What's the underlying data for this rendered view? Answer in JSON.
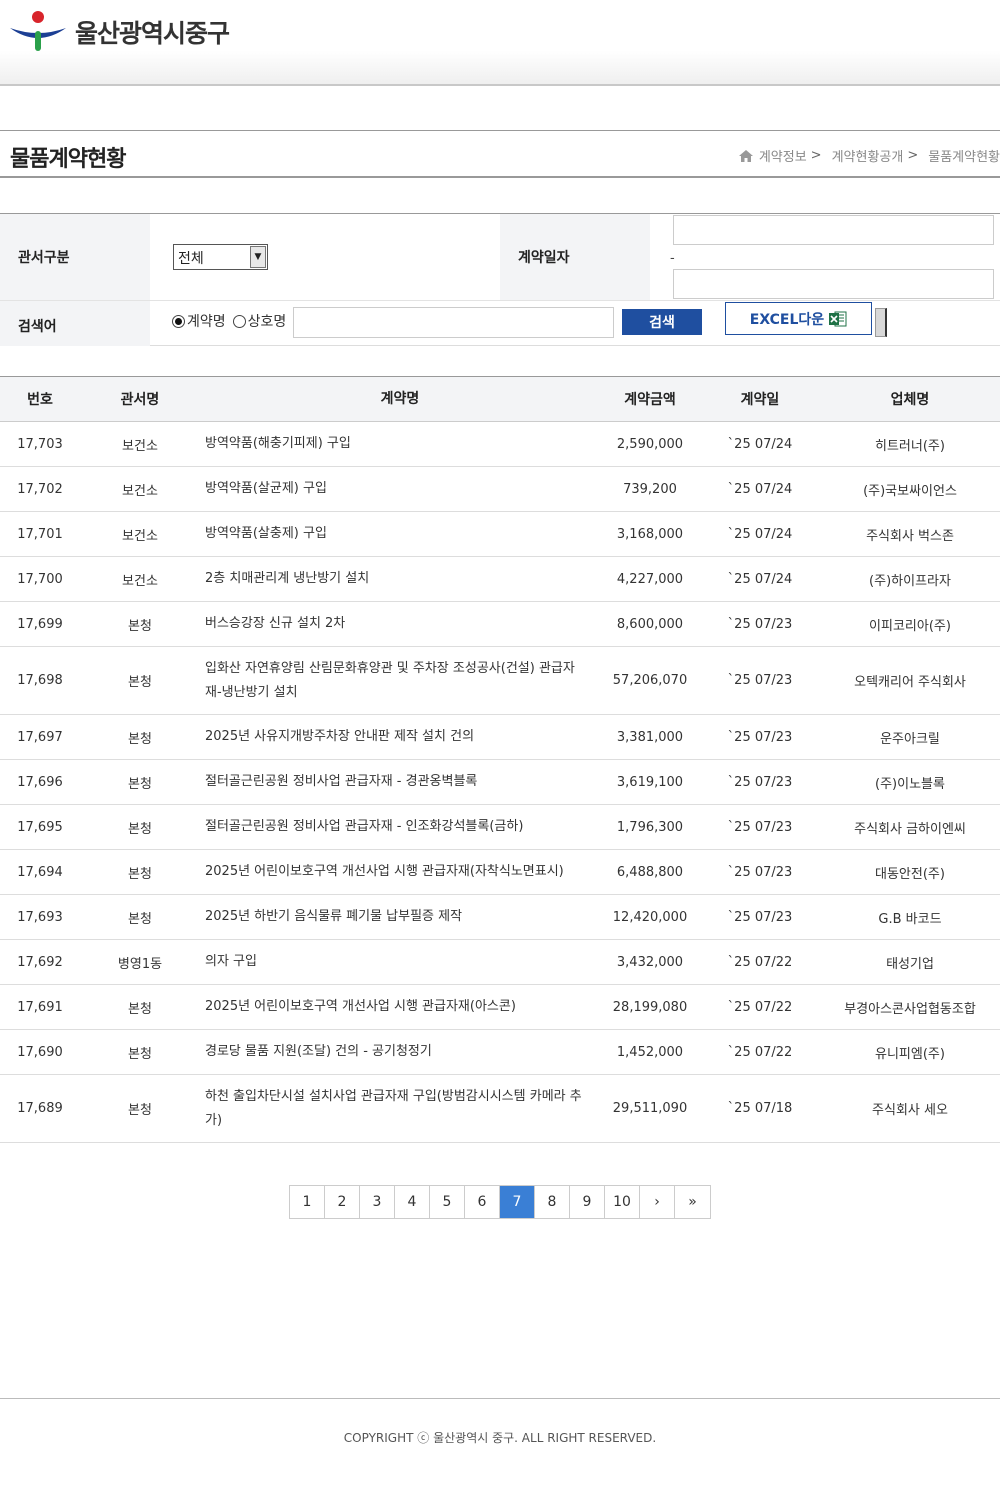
{
  "header": {
    "brand": "울산광역시중구"
  },
  "page": {
    "title": "물품계약현황",
    "breadcrumb": [
      "계약정보",
      "계약현황공개",
      "물품계약현황"
    ],
    "breadcrumb_sep": ">"
  },
  "search": {
    "dept_label": "관서구분",
    "dept_selected": "전체",
    "date_label": "계약일자",
    "date_sep": "-",
    "keyword_label": "검색어",
    "radio_contract": "계약명",
    "radio_company": "상호명",
    "search_button": "검색",
    "excel_button": "EXCEL다운"
  },
  "table": {
    "headers": [
      "번호",
      "관서명",
      "계약명",
      "계약금액",
      "계약일",
      "업체명"
    ],
    "rows": [
      {
        "no": "17,703",
        "dept": "보건소",
        "name": "방역약품(해충기피제) 구입",
        "amount": "2,590,000",
        "date": "`25 07/24",
        "vendor": "히트러너(주)"
      },
      {
        "no": "17,702",
        "dept": "보건소",
        "name": "방역약품(살균제) 구입",
        "amount": "739,200",
        "date": "`25 07/24",
        "vendor": "(주)국보싸이언스"
      },
      {
        "no": "17,701",
        "dept": "보건소",
        "name": "방역약품(살충제) 구입",
        "amount": "3,168,000",
        "date": "`25 07/24",
        "vendor": "주식회사 벅스존"
      },
      {
        "no": "17,700",
        "dept": "보건소",
        "name": "2층 치매관리계 냉난방기 설치",
        "amount": "4,227,000",
        "date": "`25 07/24",
        "vendor": "(주)하이프라자"
      },
      {
        "no": "17,699",
        "dept": "본청",
        "name": "버스승강장 신규 설치 2차",
        "amount": "8,600,000",
        "date": "`25 07/23",
        "vendor": "이피코리아(주)"
      },
      {
        "no": "17,698",
        "dept": "본청",
        "name": "입화산 자연휴양림 산림문화휴양관 및 주차장 조성공사(건설) 관급자재-냉난방기 설치",
        "amount": "57,206,070",
        "date": "`25 07/23",
        "vendor": "오텍캐리어 주식회사"
      },
      {
        "no": "17,697",
        "dept": "본청",
        "name": "2025년 사유지개방주차장 안내판 제작 설치 건의",
        "amount": "3,381,000",
        "date": "`25 07/23",
        "vendor": "운주아크릴"
      },
      {
        "no": "17,696",
        "dept": "본청",
        "name": "절터골근린공원 정비사업 관급자재 - 경관옹벽블록",
        "amount": "3,619,100",
        "date": "`25 07/23",
        "vendor": "(주)이노블록"
      },
      {
        "no": "17,695",
        "dept": "본청",
        "name": "절터골근린공원 정비사업 관급자재 - 인조화강석블록(금하)",
        "amount": "1,796,300",
        "date": "`25 07/23",
        "vendor": "주식회사 금하이엔씨"
      },
      {
        "no": "17,694",
        "dept": "본청",
        "name": "2025년 어린이보호구역 개선사업 시행 관급자재(자착식노면표시)",
        "amount": "6,488,800",
        "date": "`25 07/23",
        "vendor": "대동안전(주)"
      },
      {
        "no": "17,693",
        "dept": "본청",
        "name": "2025년 하반기 음식물류 폐기물 납부필증 제작",
        "amount": "12,420,000",
        "date": "`25 07/23",
        "vendor": "G.B 바코드"
      },
      {
        "no": "17,692",
        "dept": "병영1동",
        "name": "의자 구입",
        "amount": "3,432,000",
        "date": "`25 07/22",
        "vendor": "태성기업"
      },
      {
        "no": "17,691",
        "dept": "본청",
        "name": "2025년 어린이보호구역 개선사업 시행 관급자재(아스콘)",
        "amount": "28,199,080",
        "date": "`25 07/22",
        "vendor": "부경아스콘사업협동조합"
      },
      {
        "no": "17,690",
        "dept": "본청",
        "name": "경로당 물품 지원(조달) 건의 - 공기청정기",
        "amount": "1,452,000",
        "date": "`25 07/22",
        "vendor": "유니피엠(주)"
      },
      {
        "no": "17,689",
        "dept": "본청",
        "name": "하천 출입차단시설 설치사업 관급자재 구입(방범감시시스템 카메라 추가)",
        "amount": "29,511,090",
        "date": "`25 07/18",
        "vendor": "주식회사 세오"
      }
    ]
  },
  "pagination": {
    "pages": [
      "1",
      "2",
      "3",
      "4",
      "5",
      "6",
      "7",
      "8",
      "9",
      "10"
    ],
    "active": "7",
    "next": "›",
    "last": "»"
  },
  "footer": {
    "copyright": "COPYRIGHT ⓒ 울산광역시 중구. ALL RIGHT RESERVED."
  },
  "colors": {
    "primary": "#1f4fa0",
    "active_page": "#3a7fd5",
    "th_bg": "#f3f4f6"
  }
}
